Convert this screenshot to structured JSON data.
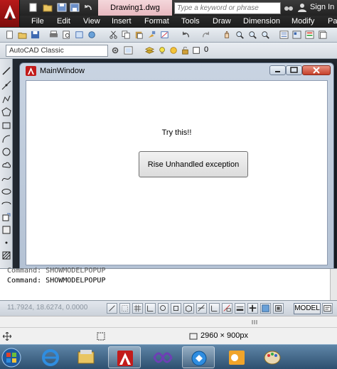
{
  "app": {
    "doc_title": "Drawing1.dwg",
    "search_placeholder": "Type a keyword or phrase",
    "signin_label": "Sign In"
  },
  "menu": {
    "items": [
      "File",
      "Edit",
      "View",
      "Insert",
      "Format",
      "Tools",
      "Draw",
      "Dimension",
      "Modify",
      "Pa"
    ]
  },
  "toolbar": {
    "workspace": "AutoCAD Classic",
    "layer_value": "0"
  },
  "dialog": {
    "title": "MainWindow",
    "label": "Try this!!",
    "button_label": "Rise Unhandled exception"
  },
  "command_line": {
    "lines": [
      "Command: SHOWMODELPOPUP",
      "Command: SHOWMODELPOPUP"
    ]
  },
  "status": {
    "coords": "11.7924, 18.6274, 0.0000",
    "model_label": "MODEL"
  },
  "explorer": {
    "image_size": "2960 × 900px"
  },
  "colors": {
    "autocad_red": "#b81a1a",
    "drawing_bg": "#212830",
    "dialog_frame": "#c9d4e2",
    "taskbar": "#2d4f6f"
  },
  "taskbar": {
    "apps": [
      "windows-start-icon",
      "ie-icon",
      "explorer-icon",
      "autocad-icon",
      "visual-studio-icon",
      "remote-icon",
      "outlook-icon",
      "paint-icon"
    ]
  }
}
